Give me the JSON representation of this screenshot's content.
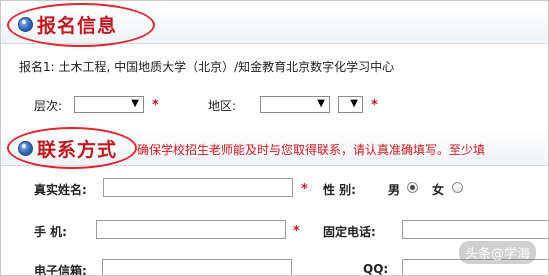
{
  "registration": {
    "title": "报名信息",
    "program_text": "报名1: 土木工程, 中国地质大学（北京）/知金教育北京数字化学习中心",
    "level_label": "层次:",
    "level_select": {
      "value": ""
    },
    "region_label": "地区:",
    "region_select": {
      "value": ""
    },
    "region_sub_select": {
      "value": ""
    },
    "required_mark": "*"
  },
  "contact": {
    "title": "联系方式",
    "note": "确保学校招生老师能及时与您取得联系，请认真准确填写。至少填",
    "realname_label": "真实姓名:",
    "gender_label": "性  别:",
    "gender_male": "男",
    "gender_female": "女",
    "gender_selected": "男",
    "mobile_label": "手    机:",
    "landline_label": "固定电话:",
    "email_label": "电子信箱:",
    "qq_label": "QQ:",
    "required_mark": "*"
  },
  "watermark": "头条@学海"
}
